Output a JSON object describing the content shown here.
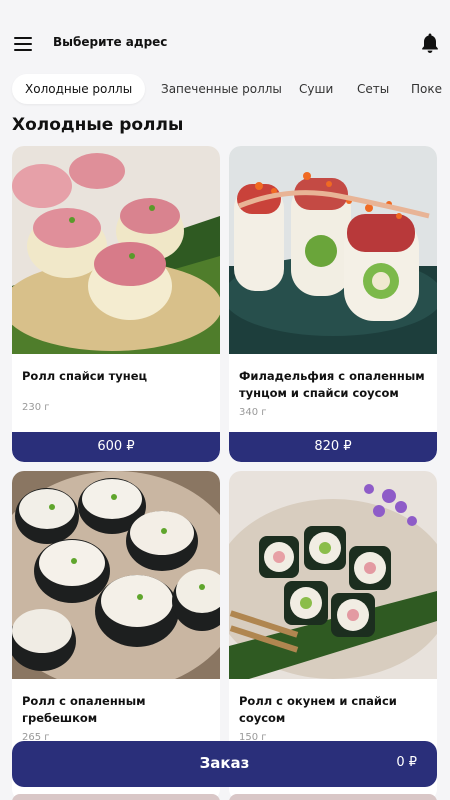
{
  "header": {
    "address_label": "Выберите адрес"
  },
  "tabs": [
    {
      "label": "Холодные роллы",
      "active": true
    },
    {
      "label": "Запеченные роллы",
      "active": false
    },
    {
      "label": "Суши",
      "active": false
    },
    {
      "label": "Сеты",
      "active": false
    },
    {
      "label": "Поке",
      "active": false
    }
  ],
  "section": {
    "title": "Холодные роллы"
  },
  "products": [
    {
      "name": "Ролл спайси тунец",
      "weight": "230 г",
      "price": "600 ₽"
    },
    {
      "name": "Филадельфия с опаленным тунцом и спайси соусом",
      "weight": "340 г",
      "price": "820 ₽"
    },
    {
      "name": "Ролл с опаленным гребешком",
      "weight": "265 г",
      "price": ""
    },
    {
      "name": "Ролл с окунем и спайси соусом",
      "weight": "150 г",
      "price": ""
    }
  ],
  "order": {
    "label": "Заказ",
    "total": "0 ₽"
  },
  "colors": {
    "accent": "#2a2f7a",
    "background": "#f5f5f7"
  },
  "icons": [
    "menu-icon",
    "bell-icon"
  ]
}
